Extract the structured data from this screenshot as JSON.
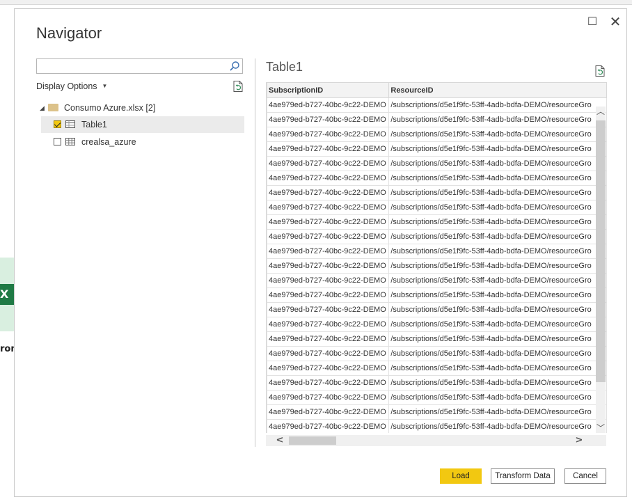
{
  "background": {
    "from_fragment": "rom",
    "excel_glyph": "X"
  },
  "dialog": {
    "title": "Navigator",
    "window_controls": {
      "maximize": "☐",
      "close": "✕"
    }
  },
  "left_panel": {
    "search_placeholder": "",
    "display_options_label": "Display Options",
    "tree": {
      "root": {
        "label": "Consumo Azure.xlsx [2]",
        "icon": "folder-icon",
        "expanded": true
      },
      "items": [
        {
          "label": "Table1",
          "checked": true,
          "selected": true,
          "icon": "table-icon"
        },
        {
          "label": "crealsa_azure",
          "checked": false,
          "selected": false,
          "icon": "sheet-icon"
        }
      ]
    }
  },
  "preview": {
    "title": "Table1",
    "columns": [
      "SubscriptionID",
      "ResourceID"
    ],
    "rows": [
      [
        "4ae979ed-b727-40bc-9c22-DEMO",
        "/subscriptions/d5e1f9fc-53ff-4adb-bdfa-DEMO/resourceGro"
      ],
      [
        "4ae979ed-b727-40bc-9c22-DEMO",
        "/subscriptions/d5e1f9fc-53ff-4adb-bdfa-DEMO/resourceGro"
      ],
      [
        "4ae979ed-b727-40bc-9c22-DEMO",
        "/subscriptions/d5e1f9fc-53ff-4adb-bdfa-DEMO/resourceGro"
      ],
      [
        "4ae979ed-b727-40bc-9c22-DEMO",
        "/subscriptions/d5e1f9fc-53ff-4adb-bdfa-DEMO/resourceGro"
      ],
      [
        "4ae979ed-b727-40bc-9c22-DEMO",
        "/subscriptions/d5e1f9fc-53ff-4adb-bdfa-DEMO/resourceGro"
      ],
      [
        "4ae979ed-b727-40bc-9c22-DEMO",
        "/subscriptions/d5e1f9fc-53ff-4adb-bdfa-DEMO/resourceGro"
      ],
      [
        "4ae979ed-b727-40bc-9c22-DEMO",
        "/subscriptions/d5e1f9fc-53ff-4adb-bdfa-DEMO/resourceGro"
      ],
      [
        "4ae979ed-b727-40bc-9c22-DEMO",
        "/subscriptions/d5e1f9fc-53ff-4adb-bdfa-DEMO/resourceGro"
      ],
      [
        "4ae979ed-b727-40bc-9c22-DEMO",
        "/subscriptions/d5e1f9fc-53ff-4adb-bdfa-DEMO/resourceGro"
      ],
      [
        "4ae979ed-b727-40bc-9c22-DEMO",
        "/subscriptions/d5e1f9fc-53ff-4adb-bdfa-DEMO/resourceGro"
      ],
      [
        "4ae979ed-b727-40bc-9c22-DEMO",
        "/subscriptions/d5e1f9fc-53ff-4adb-bdfa-DEMO/resourceGro"
      ],
      [
        "4ae979ed-b727-40bc-9c22-DEMO",
        "/subscriptions/d5e1f9fc-53ff-4adb-bdfa-DEMO/resourceGro"
      ],
      [
        "4ae979ed-b727-40bc-9c22-DEMO",
        "/subscriptions/d5e1f9fc-53ff-4adb-bdfa-DEMO/resourceGro"
      ],
      [
        "4ae979ed-b727-40bc-9c22-DEMO",
        "/subscriptions/d5e1f9fc-53ff-4adb-bdfa-DEMO/resourceGro"
      ],
      [
        "4ae979ed-b727-40bc-9c22-DEMO",
        "/subscriptions/d5e1f9fc-53ff-4adb-bdfa-DEMO/resourceGro"
      ],
      [
        "4ae979ed-b727-40bc-9c22-DEMO",
        "/subscriptions/d5e1f9fc-53ff-4adb-bdfa-DEMO/resourceGro"
      ],
      [
        "4ae979ed-b727-40bc-9c22-DEMO",
        "/subscriptions/d5e1f9fc-53ff-4adb-bdfa-DEMO/resourceGro"
      ],
      [
        "4ae979ed-b727-40bc-9c22-DEMO",
        "/subscriptions/d5e1f9fc-53ff-4adb-bdfa-DEMO/resourceGro"
      ],
      [
        "4ae979ed-b727-40bc-9c22-DEMO",
        "/subscriptions/d5e1f9fc-53ff-4adb-bdfa-DEMO/resourceGro"
      ],
      [
        "4ae979ed-b727-40bc-9c22-DEMO",
        "/subscriptions/d5e1f9fc-53ff-4adb-bdfa-DEMO/resourceGro"
      ],
      [
        "4ae979ed-b727-40bc-9c22-DEMO",
        "/subscriptions/d5e1f9fc-53ff-4adb-bdfa-DEMO/resourceGro"
      ],
      [
        "4ae979ed-b727-40bc-9c22-DEMO",
        "/subscriptions/d5e1f9fc-53ff-4adb-bdfa-DEMO/resourceGro"
      ],
      [
        "4ae979ed-b727-40bc-9c22-DEMO",
        "/subscriptions/d5e1f9fc-53ff-4adb-bdfa-DEMO/resourceGro"
      ],
      [
        "4ae979ed-b727-40bc-9c22-DEMO",
        "/subscriptions/d5e1f9fc-53ff-4adb-bdfa-DEMO/resourceGro"
      ]
    ]
  },
  "footer": {
    "load_label": "Load",
    "transform_label": "Transform Data",
    "cancel_label": "Cancel"
  },
  "colors": {
    "accent": "#f2c811",
    "selection": "#ebebeb",
    "folder": "#dcc28a"
  }
}
